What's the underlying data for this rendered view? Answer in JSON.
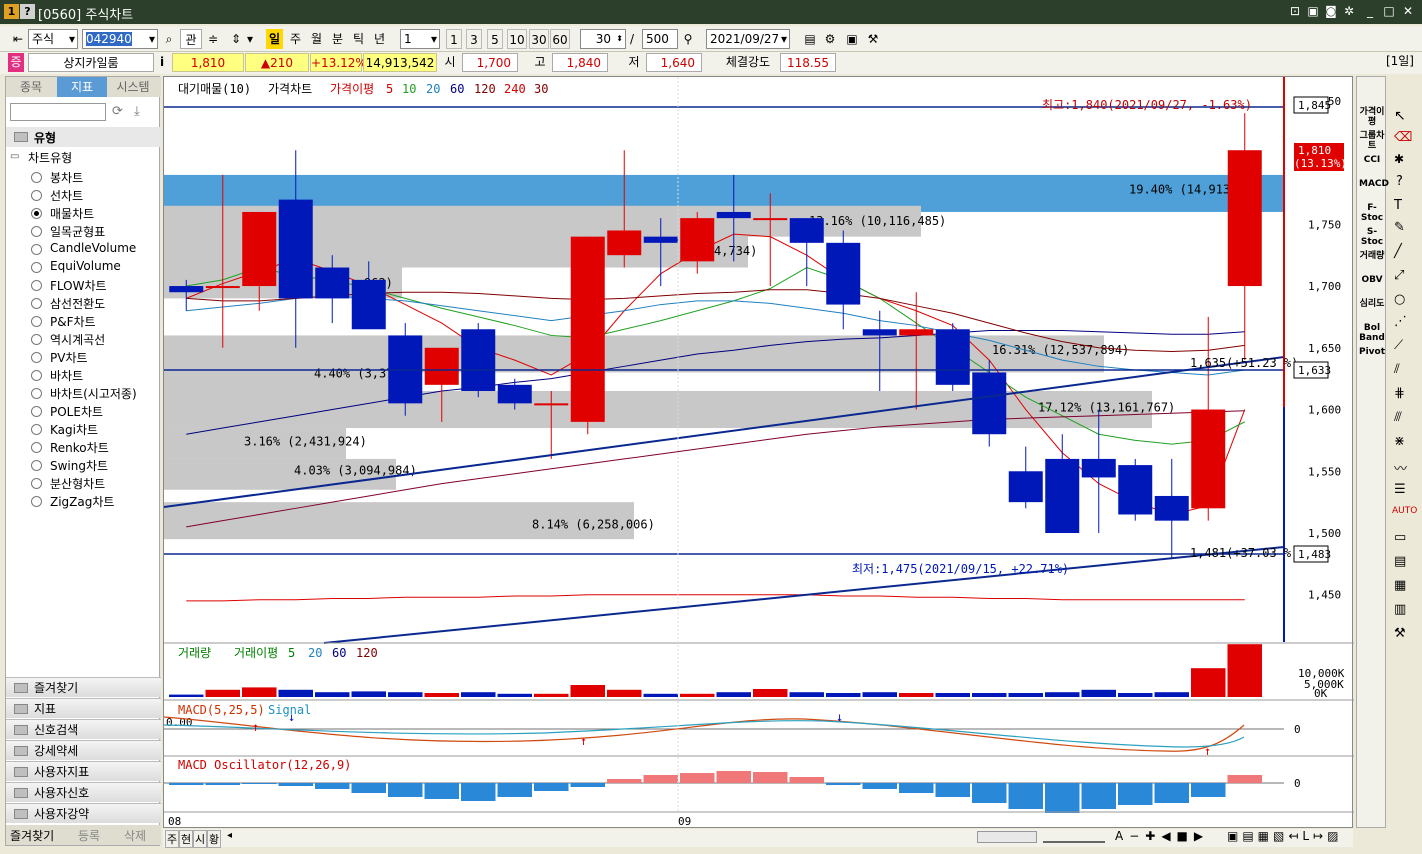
{
  "window": {
    "title": "[0560] 주식차트",
    "icons": [
      "1",
      "?"
    ]
  },
  "toolbar": {
    "market": "주식",
    "code": "042940",
    "btn_gwan": "관",
    "periods": [
      "일",
      "주",
      "월",
      "분",
      "틱",
      "년"
    ],
    "count_select": "1",
    "quick": [
      "1",
      "3",
      "5",
      "10",
      "30",
      "60"
    ],
    "n_view": "30",
    "slash": "/",
    "n_total": "500",
    "date": "2021/09/27"
  },
  "quote": {
    "badge": "증",
    "name": "상지카일룸",
    "info": "i",
    "price": "1,810",
    "change": "▲210",
    "rate": "+13.12%",
    "volume": "14,913,542",
    "open_label": "시",
    "open": "1,700",
    "high_label": "고",
    "high": "1,840",
    "low_label": "저",
    "low": "1,640",
    "strength_label": "체결강도",
    "strength": "118.55",
    "period_tag": "[1일]"
  },
  "left": {
    "tabs": [
      "종목",
      "지표",
      "시스템"
    ],
    "root": "유형",
    "group": "차트유형",
    "types": [
      "봉차트",
      "선차트",
      "매물차트",
      "일목균형표",
      "CandleVolume",
      "EquiVolume",
      "FLOW차트",
      "삼선전환도",
      "P&F차트",
      "역시계곡선",
      "PV차트",
      "바차트",
      "바차트(시고저종)",
      "POLE차트",
      "Kagi차트",
      "Renko차트",
      "Swing차트",
      "분산형차트",
      "ZigZag차트"
    ],
    "selected": "매물차트",
    "folders": [
      "즐겨찾기",
      "지표",
      "신호검색",
      "강세약세",
      "사용자지표",
      "사용자신호",
      "사용자강약"
    ],
    "bottom_btns": [
      "즐겨찾기",
      "등록",
      "삭제"
    ]
  },
  "chart": {
    "legend": {
      "a": "대기매물(10)",
      "b": "가격차트",
      "c": "가격이평",
      "ma5": "5",
      "ma10": "10",
      "ma20": "20",
      "ma60": "60",
      "ma120": "120",
      "ma240": "240",
      "ma30": "30"
    },
    "max_note": "최고:1,840(2021/09/27, -1.63%)",
    "min_note": "최저:1,475(2021/09/15, +22.71%)",
    "line_note_1": "1,635(+51.23 %)",
    "line_note_2": "1,481(+37.03 %)",
    "current_tag": "1,810",
    "current_rate": "(13.13%)",
    "tags": [
      "1,845",
      "1,633",
      "1,483"
    ],
    "y_ticks": [
      "1,850",
      "1,750",
      "1,700",
      "1,650",
      "1,600",
      "1,550",
      "1,500",
      "1,450"
    ],
    "x_ticks": [
      "08",
      "09"
    ],
    "volume_profile": [
      {
        "label": "19.40% (14,913,5"
      },
      {
        "label": "13.16% (10,116,485)"
      },
      {
        "label": "4,734)"
      },
      {
        "label": "962)"
      },
      {
        "label": "16.31% (12,537,894)"
      },
      {
        "label": "4.40% (3,37"
      },
      {
        "label": "17.12% (13,161,767)"
      },
      {
        "label": "3.16% (2,431,924)"
      },
      {
        "label": "4.03% (3,094,984)"
      },
      {
        "label": "8.14% (6,258,006)"
      }
    ],
    "vol_legend": {
      "a": "거래량",
      "b": "거래이평",
      "n5": "5",
      "n20": "20",
      "n60": "60",
      "n120": "120"
    },
    "vol_ticks": [
      "10,000K",
      "5,000K",
      "0K"
    ],
    "macd_legend": {
      "a": "MACD(5,25,5)",
      "b": "Signal"
    },
    "macd_left": "0.00",
    "macd_zero": "0",
    "osc_legend": "MACD Oscillator(12,26,9)",
    "osc_zero": "0"
  },
  "right_tools": [
    "가격이평",
    "그룹차트",
    "CCI",
    "MACD",
    "F-Stoc",
    "S-Stoc",
    "거래량",
    "OBV",
    "심리도",
    "Bol Band",
    "Pivot"
  ],
  "bottom": {
    "tabs": [
      "주",
      "현",
      "시",
      "황"
    ]
  },
  "colors": {
    "up": "#e00000",
    "down": "#0018b8",
    "profile": "#c8c8c8",
    "profile_hi": "#4fa0d8"
  }
}
